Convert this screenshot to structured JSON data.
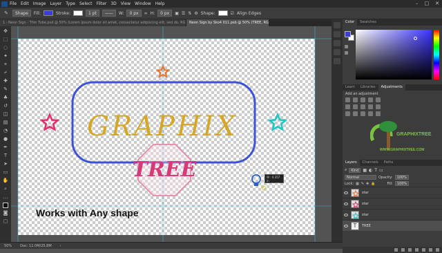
{
  "menu": [
    "File",
    "Edit",
    "Image",
    "Layer",
    "Type",
    "Select",
    "Filter",
    "3D",
    "View",
    "Window",
    "Help"
  ],
  "options": {
    "tool_mode": "Shape",
    "fill_label": "Fill:",
    "stroke_label": "Stroke:",
    "stroke_width": "1 pt",
    "w_label": "W:",
    "w_value": "0 px",
    "h_label": "H:",
    "h_value": "0 px",
    "shape_label": "Shape:",
    "align_edges": "Align Edges"
  },
  "tabs": [
    {
      "label": "1 - Neon Sign - Thin Tube.psd @ 50% (Lorem ipsum dolor sit amet, consectetur adipiscing elit, sed do, RGB/8)",
      "active": false
    },
    {
      "label": "Neon Sign by Sko4 011.psb @ 50% (TREE, RGB/8)",
      "active": true
    }
  ],
  "canvas": {
    "title_word": "GRAPHIX",
    "sub_word": "TREE",
    "caption": "Works with Any shape",
    "measure_w": "W : 0.357 in",
    "measure_h": "H : 0.457 in"
  },
  "status": {
    "zoom": "50%",
    "doc": "Doc: 11.0M/25.8M"
  },
  "color_panel": {
    "tabs": [
      "Color",
      "Swatches"
    ],
    "fg_color": "#3c3cd9"
  },
  "adjust_panel": {
    "tabs": [
      "Learn",
      "Libraries",
      "Adjustments"
    ],
    "add_label": "Add an adjustment"
  },
  "brand": {
    "name": "GRAPHIXTREE",
    "url": "WWW.GRAPHIXTREE.COM"
  },
  "layers_panel": {
    "tabs": [
      "Layers",
      "Channels",
      "Paths"
    ],
    "kind_label": "Kind",
    "blend_mode": "Normal",
    "opacity_label": "Opacity:",
    "opacity_value": "100%",
    "lock_label": "Lock:",
    "fill_label": "Fill:",
    "fill_value": "100%",
    "layers": [
      {
        "name": "star",
        "color": "#e8702a"
      },
      {
        "name": "star",
        "color": "#e0306a"
      },
      {
        "name": "star",
        "color": "#22c4c4"
      },
      {
        "name": "TREE",
        "color": "#444444"
      }
    ]
  },
  "colors": {
    "frame": "#3d52d5",
    "title": "#d4a62a",
    "octagon": "#e887a8",
    "tree_text": "#d63a78",
    "star_orange": "#e8702a",
    "star_pink": "#e0306a",
    "star_cyan": "#22c4c4",
    "guide": "#36b9d6"
  }
}
